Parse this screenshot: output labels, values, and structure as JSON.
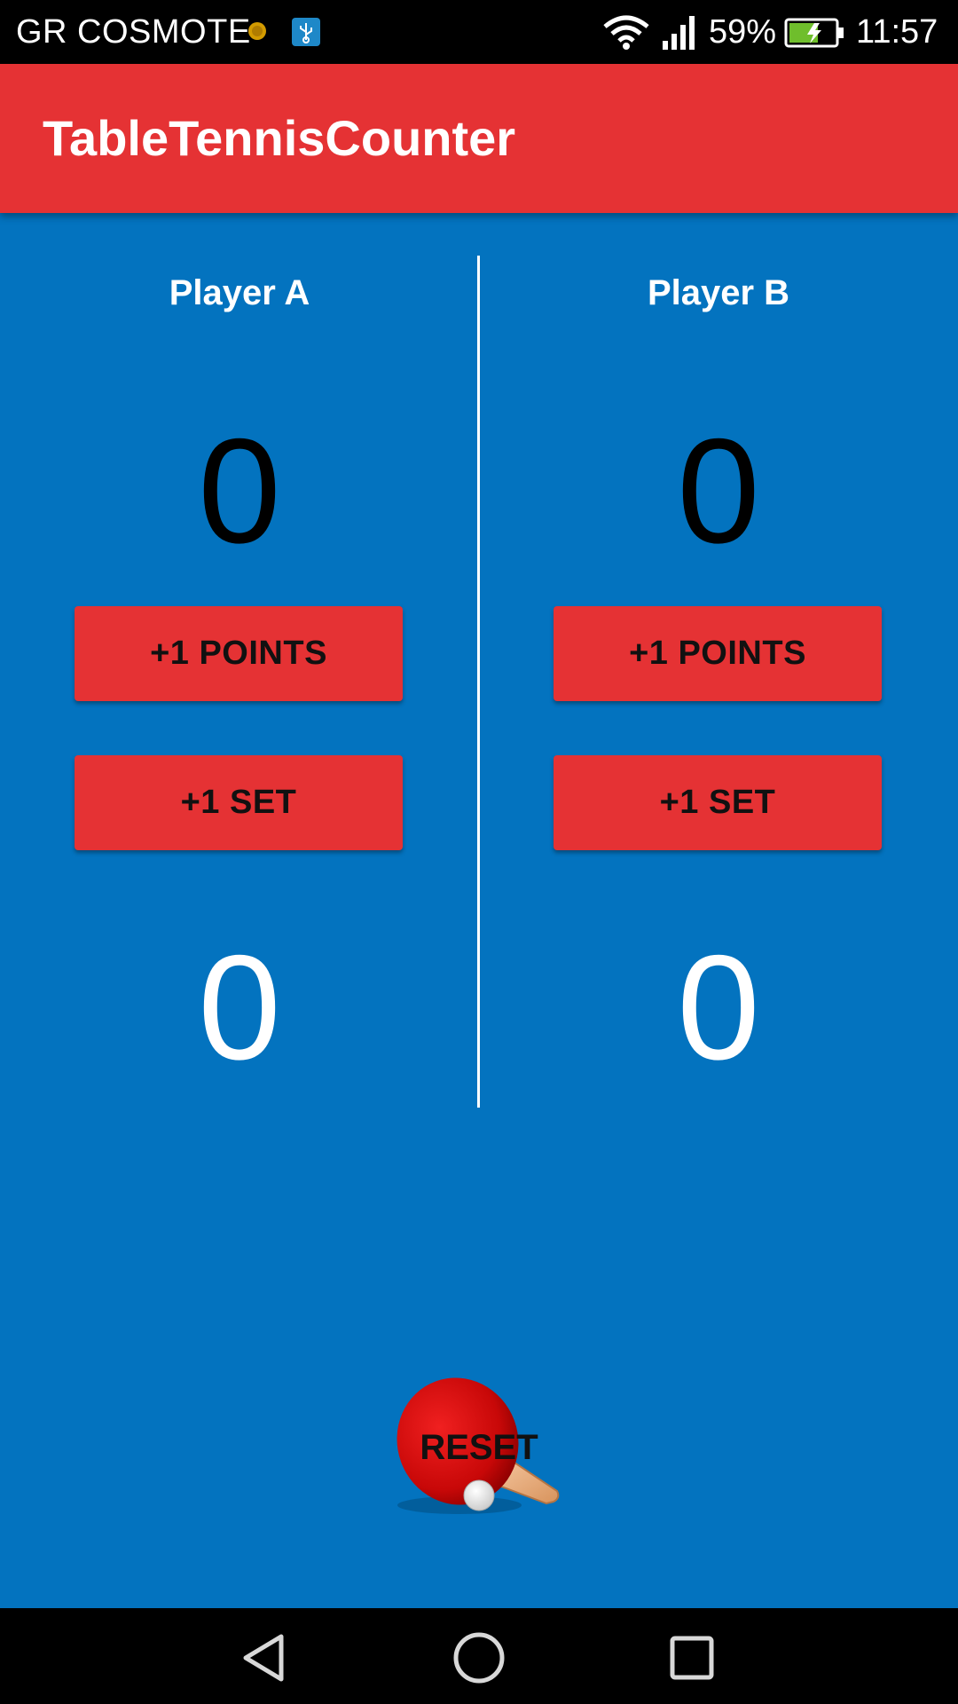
{
  "status_bar": {
    "carrier": "GR COSMOTE",
    "battery_percent": "59%",
    "time": "11:57",
    "icons": [
      "notification-dot-icon",
      "usb-icon",
      "wifi-icon",
      "signal-icon",
      "battery-charging-icon"
    ]
  },
  "app_bar": {
    "title": "TableTennisCounter"
  },
  "players": [
    {
      "name": "Player A",
      "points": "0",
      "points_button_label": "+1 POINTS",
      "set_button_label": "+1 SET",
      "sets": "0"
    },
    {
      "name": "Player B",
      "points": "0",
      "points_button_label": "+1 POINTS",
      "set_button_label": "+1 SET",
      "sets": "0"
    }
  ],
  "reset": {
    "label": "RESET",
    "icon": "ping-pong-paddle-icon"
  },
  "nav_bar": {
    "icons": [
      "back-icon",
      "home-icon",
      "recents-icon"
    ]
  },
  "colors": {
    "background": "#0373bf",
    "accent_red": "#e53234",
    "status_bar": "#000000"
  }
}
